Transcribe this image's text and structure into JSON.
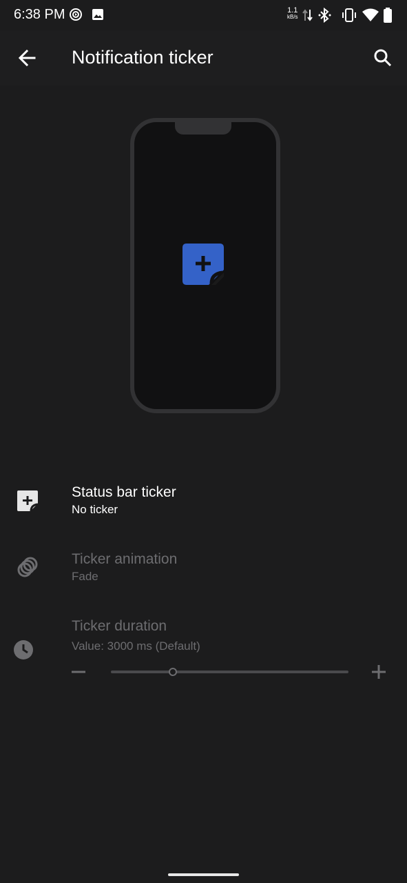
{
  "status_bar": {
    "time": "6:38 PM",
    "net_speed_value": "1.1",
    "net_speed_unit": "kB/s",
    "icons": [
      "play-circle-icon",
      "image-icon",
      "data-updown-icon",
      "bluetooth-icon",
      "vibrate-icon",
      "wifi-icon",
      "battery-icon"
    ]
  },
  "app_bar": {
    "title": "Notification ticker",
    "back_icon": "arrow-back-icon",
    "search_icon": "search-icon"
  },
  "preview": {
    "icon": "note-add-icon",
    "accent": "#3462c8"
  },
  "settings": {
    "status_bar_ticker": {
      "title": "Status bar ticker",
      "summary": "No ticker",
      "icon": "note-add-icon"
    },
    "ticker_animation": {
      "title": "Ticker animation",
      "summary": "Fade",
      "icon": "rings-icon"
    },
    "ticker_duration": {
      "title": "Ticker duration",
      "value_text": "Value: 3000 ms (Default)",
      "icon": "clock-icon",
      "slider_fraction": 0.26
    }
  },
  "colors": {
    "background": "#1c1c1d",
    "disabled_text": "#6d6d70",
    "accent": "#3462c8"
  }
}
